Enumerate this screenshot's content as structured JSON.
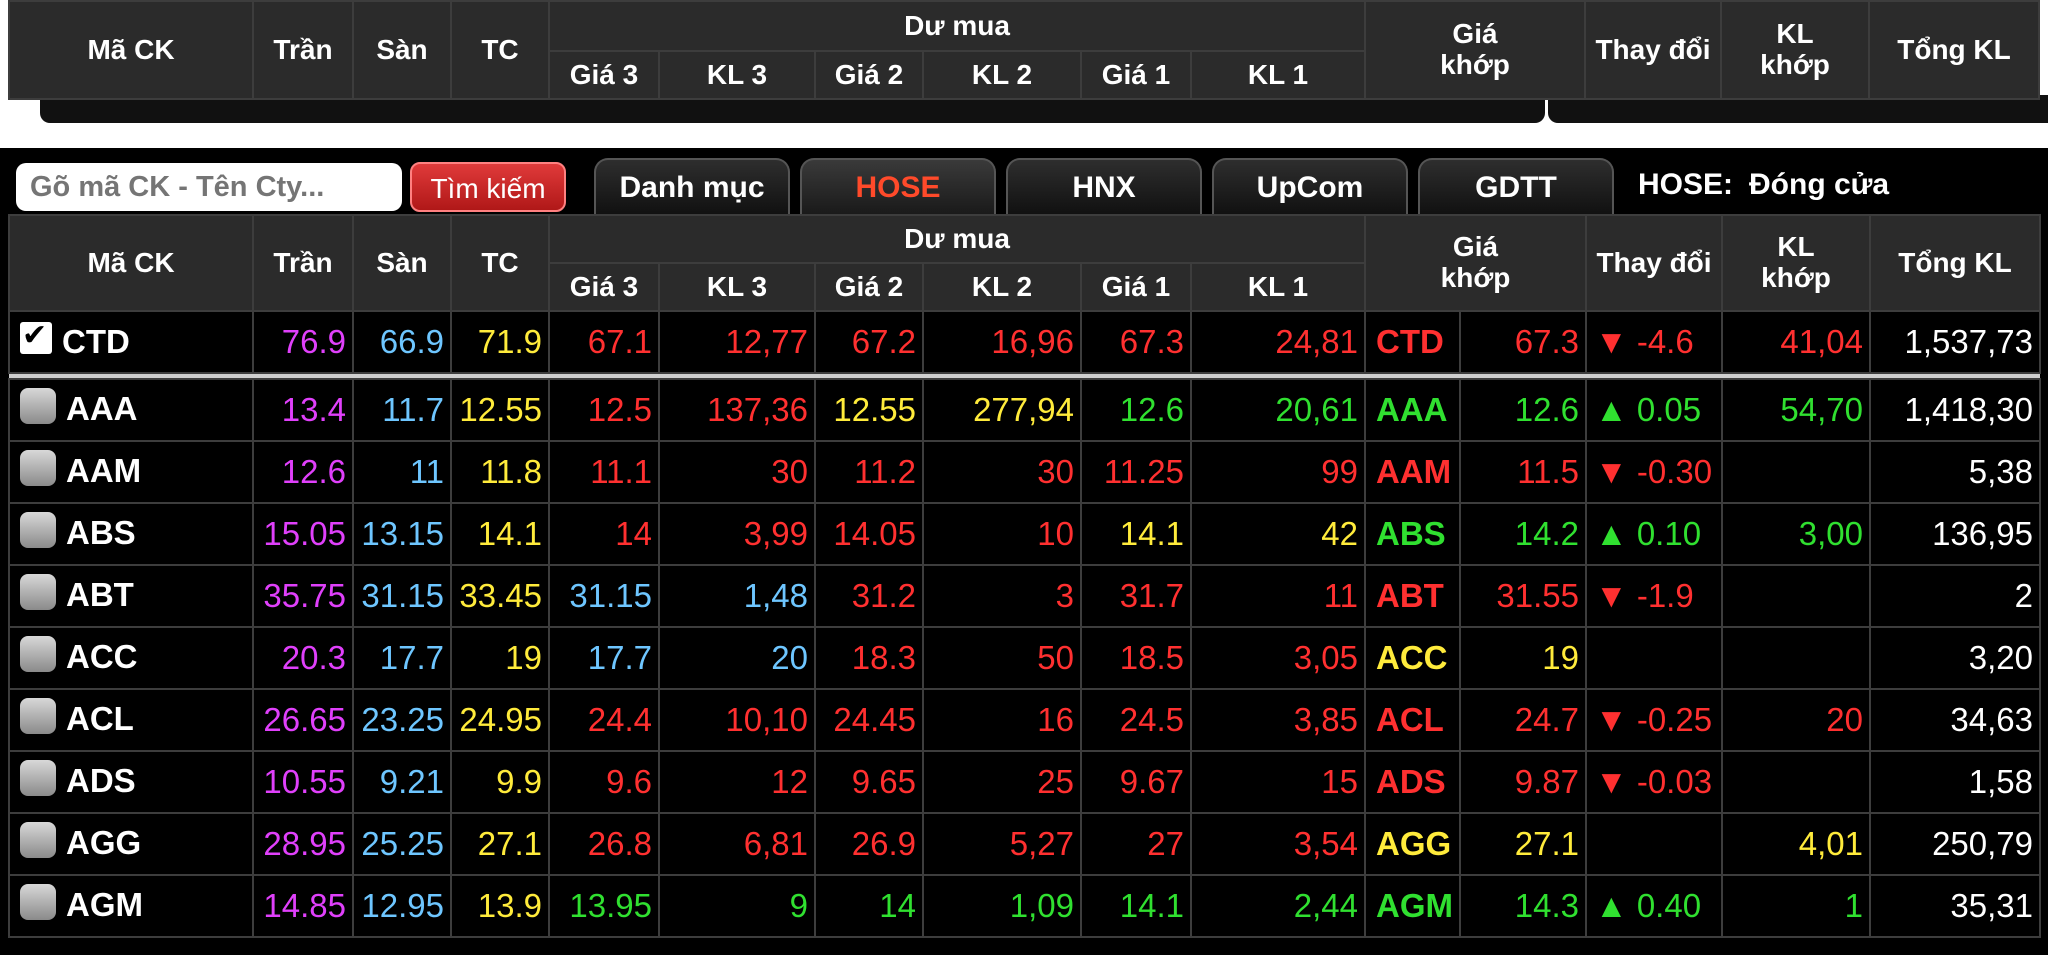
{
  "headers": {
    "symbol": "Mã CK",
    "ceiling": "Trần",
    "floor": "Sàn",
    "ref": "TC",
    "bid_group": "Dư mua",
    "bid": [
      "Giá 3",
      "KL 3",
      "Giá 2",
      "KL 2",
      "Giá 1",
      "KL 1"
    ],
    "match_price_1": "Giá",
    "match_price_2": "khớp",
    "change": "Thay đổi",
    "match_vol_1": "KL",
    "match_vol_2": "khớp",
    "total_vol": "Tổng KL"
  },
  "toolbar": {
    "search_placeholder": "Gõ mã CK - Tên Cty...",
    "search_button": "Tìm kiếm",
    "tabs": [
      "Danh mục",
      "HOSE",
      "HNX",
      "UpCom",
      "GDTT"
    ],
    "active_tab": "HOSE",
    "status_label": "HOSE:",
    "status_value": "Đóng cửa"
  },
  "colors": {
    "ceiling": "#e040fb",
    "floor": "#6ec6ff",
    "ref": "#ffeb3b",
    "down": "#ff3030",
    "up": "#30e030"
  },
  "rows": [
    {
      "sym": "CTD",
      "checked": true,
      "tran": "76.9",
      "san": "66.9",
      "tc": "71.9",
      "g3": "67.1",
      "k3": "12,77",
      "g2": "67.2",
      "k2": "16,96",
      "g1": "67.3",
      "k1": "24,81",
      "msym": "CTD",
      "mp": "67.3",
      "chg": "▼ -4.6",
      "mv": "41,04",
      "tot": "1,537,73",
      "c3": "red",
      "c2": "red",
      "c1": "red",
      "cm": "red",
      "cmv": "red"
    },
    {
      "sym": "AAA",
      "checked": false,
      "tran": "13.4",
      "san": "11.7",
      "tc": "12.55",
      "g3": "12.5",
      "k3": "137,36",
      "g2": "12.55",
      "k2": "277,94",
      "g1": "12.6",
      "k1": "20,61",
      "msym": "AAA",
      "mp": "12.6",
      "chg": "▲ 0.05",
      "mv": "54,70",
      "tot": "1,418,30",
      "c3": "red",
      "c2": "yel",
      "c1": "grn",
      "cm": "grn",
      "cmv": "grn"
    },
    {
      "sym": "AAM",
      "checked": false,
      "tran": "12.6",
      "san": "11",
      "tc": "11.8",
      "g3": "11.1",
      "k3": "30",
      "g2": "11.2",
      "k2": "30",
      "g1": "11.25",
      "k1": "99",
      "msym": "AAM",
      "mp": "11.5",
      "chg": "▼ -0.30",
      "mv": "",
      "tot": "5,38",
      "c3": "red",
      "c2": "red",
      "c1": "red",
      "cm": "red",
      "cmv": "red"
    },
    {
      "sym": "ABS",
      "checked": false,
      "tran": "15.05",
      "san": "13.15",
      "tc": "14.1",
      "g3": "14",
      "k3": "3,99",
      "g2": "14.05",
      "k2": "10",
      "g1": "14.1",
      "k1": "42",
      "msym": "ABS",
      "mp": "14.2",
      "chg": "▲ 0.10",
      "mv": "3,00",
      "tot": "136,95",
      "c3": "red",
      "c2": "red",
      "c1": "yel",
      "cm": "grn",
      "cmv": "grn"
    },
    {
      "sym": "ABT",
      "checked": false,
      "tran": "35.75",
      "san": "31.15",
      "tc": "33.45",
      "g3": "31.15",
      "k3": "1,48",
      "g2": "31.2",
      "k2": "3",
      "g1": "31.7",
      "k1": "11",
      "msym": "ABT",
      "mp": "31.55",
      "chg": "▼ -1.9",
      "mv": "",
      "tot": "2",
      "c3": "cyan",
      "c2": "red",
      "c1": "red",
      "cm": "red",
      "cmv": "red"
    },
    {
      "sym": "ACC",
      "checked": false,
      "tran": "20.3",
      "san": "17.7",
      "tc": "19",
      "g3": "17.7",
      "k3": "20",
      "g2": "18.3",
      "k2": "50",
      "g1": "18.5",
      "k1": "3,05",
      "msym": "ACC",
      "mp": "19",
      "chg": "",
      "mv": "",
      "tot": "3,20",
      "c3": "cyan",
      "c2": "red",
      "c1": "red",
      "cm": "yel",
      "cmv": "yel"
    },
    {
      "sym": "ACL",
      "checked": false,
      "tran": "26.65",
      "san": "23.25",
      "tc": "24.95",
      "g3": "24.4",
      "k3": "10,10",
      "g2": "24.45",
      "k2": "16",
      "g1": "24.5",
      "k1": "3,85",
      "msym": "ACL",
      "mp": "24.7",
      "chg": "▼ -0.25",
      "mv": "20",
      "tot": "34,63",
      "c3": "red",
      "c2": "red",
      "c1": "red",
      "cm": "red",
      "cmv": "red"
    },
    {
      "sym": "ADS",
      "checked": false,
      "tran": "10.55",
      "san": "9.21",
      "tc": "9.9",
      "g3": "9.6",
      "k3": "12",
      "g2": "9.65",
      "k2": "25",
      "g1": "9.67",
      "k1": "15",
      "msym": "ADS",
      "mp": "9.87",
      "chg": "▼ -0.03",
      "mv": "",
      "tot": "1,58",
      "c3": "red",
      "c2": "red",
      "c1": "red",
      "cm": "red",
      "cmv": "red"
    },
    {
      "sym": "AGG",
      "checked": false,
      "tran": "28.95",
      "san": "25.25",
      "tc": "27.1",
      "g3": "26.8",
      "k3": "6,81",
      "g2": "26.9",
      "k2": "5,27",
      "g1": "27",
      "k1": "3,54",
      "msym": "AGG",
      "mp": "27.1",
      "chg": "",
      "mv": "4,01",
      "tot": "250,79",
      "c3": "red",
      "c2": "red",
      "c1": "red",
      "cm": "yel",
      "cmv": "yel"
    },
    {
      "sym": "AGM",
      "checked": false,
      "tran": "14.85",
      "san": "12.95",
      "tc": "13.9",
      "g3": "13.95",
      "k3": "9",
      "g2": "14",
      "k2": "1,09",
      "g1": "14.1",
      "k1": "2,44",
      "msym": "AGM",
      "mp": "14.3",
      "chg": "▲ 0.40",
      "mv": "1",
      "tot": "35,31",
      "c3": "grn",
      "c2": "grn",
      "c1": "grn",
      "cm": "grn",
      "cmv": "grn"
    }
  ]
}
